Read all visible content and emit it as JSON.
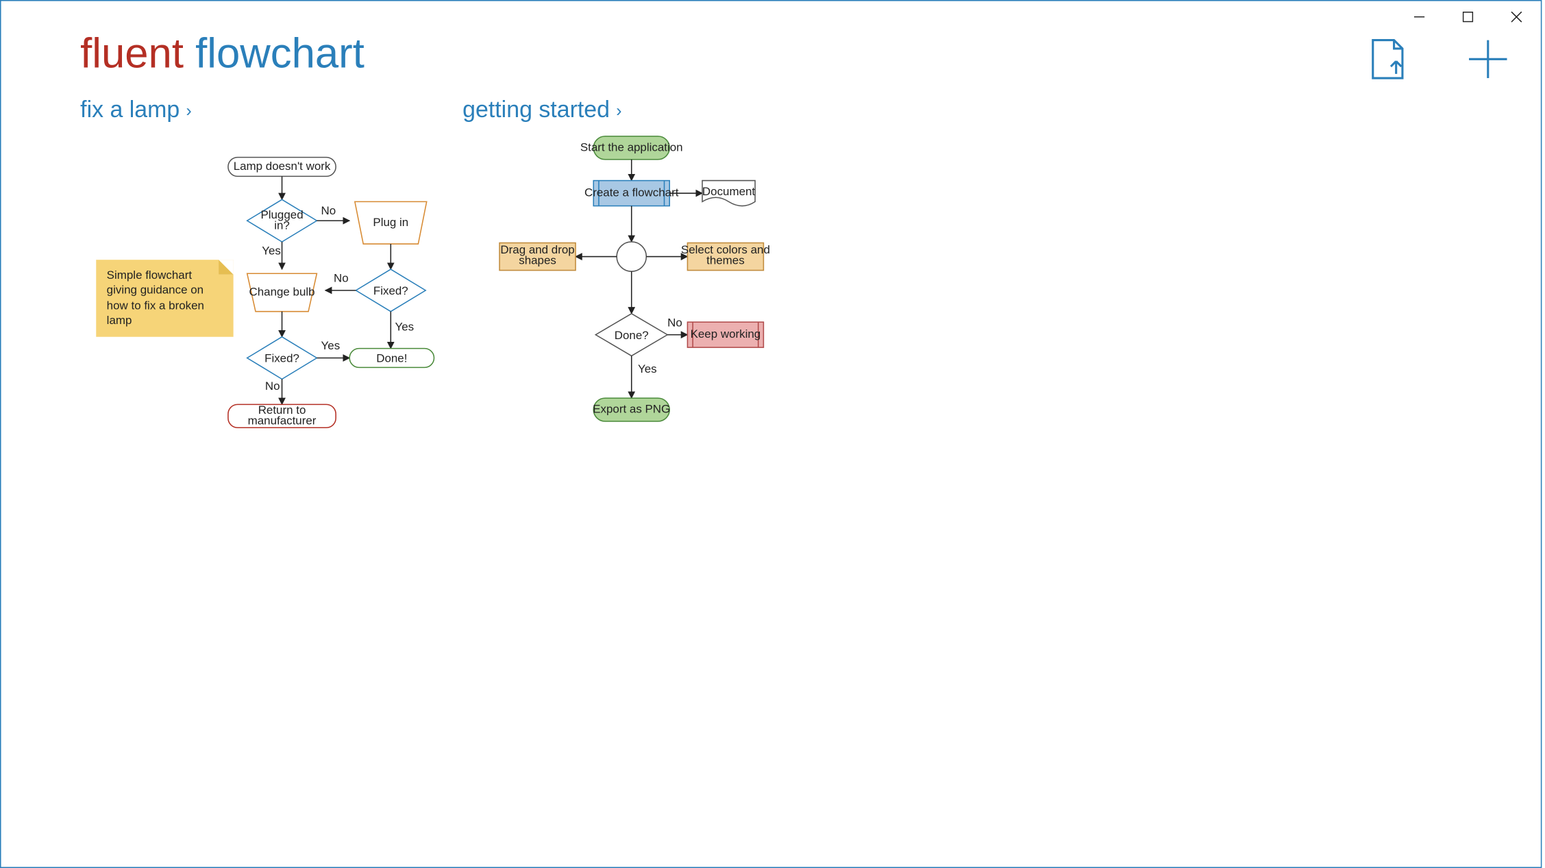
{
  "app_title": {
    "part1": "fluent",
    "part2": "flowchart"
  },
  "sections": {
    "fix_lamp": "fix a lamp",
    "getting_started": "getting started"
  },
  "sticky_note": "Simple flowchart giving guidance on how to fix a broken lamp",
  "lamp_chart": {
    "start": "Lamp doesn't work",
    "plugged": "Plugged in?",
    "plug_in": "Plug in",
    "fixed1": "Fixed?",
    "change_bulb": "Change bulb",
    "fixed2": "Fixed?",
    "done": "Done!",
    "return_mfr1": "Return to",
    "return_mfr2": "manufacturer",
    "labels": {
      "yes": "Yes",
      "no": "No"
    }
  },
  "gs_chart": {
    "start": "Start the application",
    "create": "Create a flowchart",
    "document": "Document",
    "drag": "Drag and drop shapes",
    "select": "Select colors and themes",
    "done": "Done?",
    "keep": "Keep working",
    "export": "Export as PNG",
    "labels": {
      "yes": "Yes",
      "no": "No"
    }
  },
  "colors": {
    "blue": "#2a7fba",
    "green_fill": "#b0d69a",
    "green_stroke": "#4a8a3a",
    "lblue_fill": "#a8c8e4",
    "tan_fill": "#f4d5a0",
    "tan_stroke": "#c08a3a",
    "pink_fill": "#ecb0b0",
    "pink_stroke": "#b04a4a",
    "orange": "#d78a32",
    "red": "#b42f24",
    "done_green": "#4a8a3a"
  }
}
